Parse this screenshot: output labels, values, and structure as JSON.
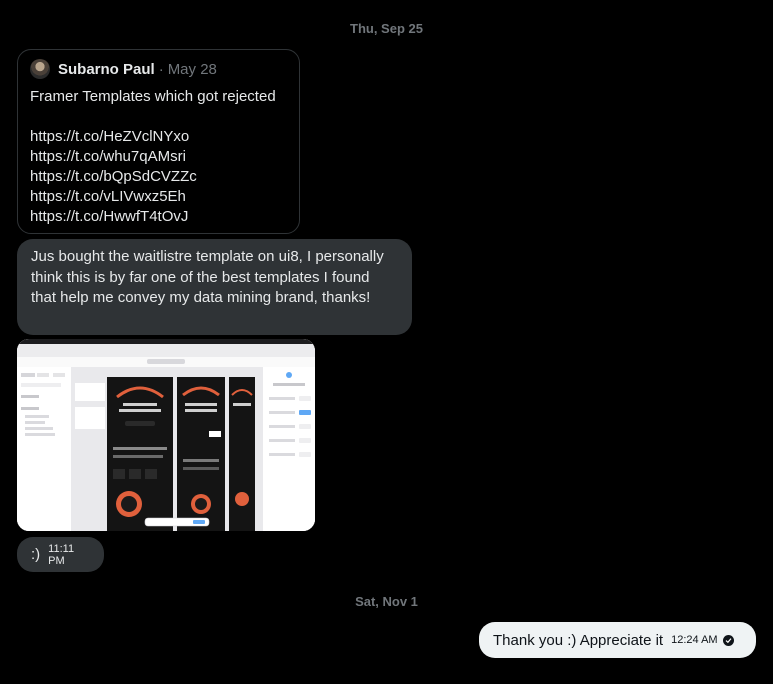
{
  "dates": {
    "first": "Thu, Sep 25",
    "second": "Sat, Nov 1"
  },
  "quoted_tweet": {
    "author": "Subarno Paul",
    "separator": "·",
    "date": "May 28",
    "text": "Framer Templates which got rejected",
    "links": [
      "https://t.co/HeZVclNYxo",
      "https://t.co/whu7qAMsri",
      "https://t.co/bQpSdCVZZc",
      "https://t.co/vLIVwxz5Eh",
      "https://t.co/HwwfT4tOvJ"
    ]
  },
  "messages": [
    {
      "text": "Jus bought the waitlistre template on ui8, I personally think this is by far one of the best templates I found that help me convey my data mining brand, thanks!"
    },
    {
      "text": ":)",
      "time": "11:11 PM"
    },
    {
      "text": "Thank you :) Appreciate it",
      "time": "12:24 AM"
    }
  ],
  "colors": {
    "background": "#000000",
    "received_bubble": "#2f3336",
    "sent_bubble": "#eff3f4",
    "muted_text": "#71767b",
    "accent_orange": "#e0603c"
  }
}
